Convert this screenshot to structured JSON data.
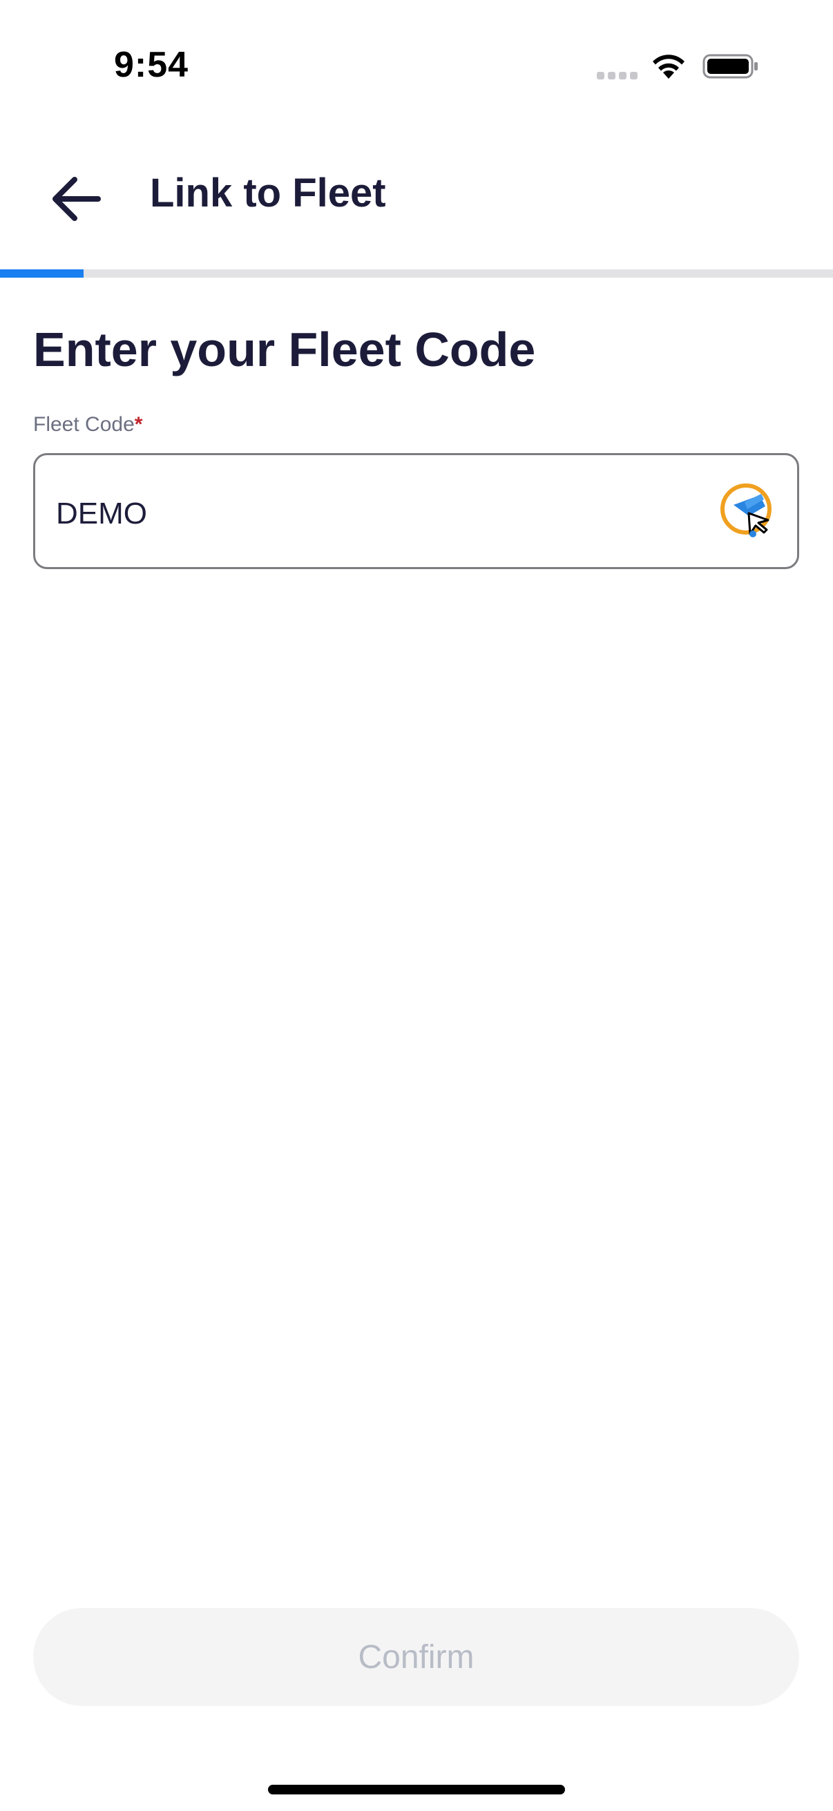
{
  "status_bar": {
    "time": "9:54",
    "signal_icon": "signal-dots-icon",
    "wifi_icon": "wifi-icon",
    "battery_icon": "battery-icon"
  },
  "nav": {
    "back_icon": "arrow-left-icon",
    "title": "Link to Fleet"
  },
  "progress": {
    "fraction": 0.1,
    "fill_color": "#1a7ff0",
    "track_color": "#e3e3e6"
  },
  "form": {
    "heading": "Enter your Fleet Code",
    "field_label": "Fleet Code",
    "required_marker": "*",
    "field_value": "DEMO",
    "field_icon": "scan-icon"
  },
  "footer": {
    "confirm_label": "Confirm"
  },
  "colors": {
    "accent": "#1a7ff0",
    "text_primary": "#1c1c3a",
    "required": "#c0242c",
    "disabled_text": "#b8bcc6",
    "scan_ring": "#f0a020"
  }
}
